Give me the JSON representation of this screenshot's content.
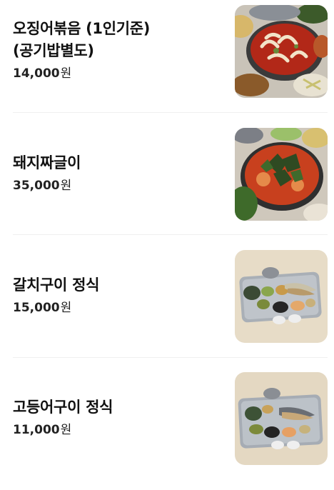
{
  "menu": {
    "currency": "원",
    "items": [
      {
        "name": "오징어볶음 (1인기준)(공기밥별도)",
        "price": "14,000",
        "photo": "squid-stir-fry-photo"
      },
      {
        "name": "돼지짜글이",
        "price": "35,000",
        "photo": "pork-jjageuli-photo"
      },
      {
        "name": "갈치구이 정식",
        "price": "15,000",
        "photo": "grilled-hairtail-set-photo"
      },
      {
        "name": "고등어구이 정식",
        "price": "11,000",
        "photo": "grilled-mackerel-set-photo"
      }
    ]
  }
}
